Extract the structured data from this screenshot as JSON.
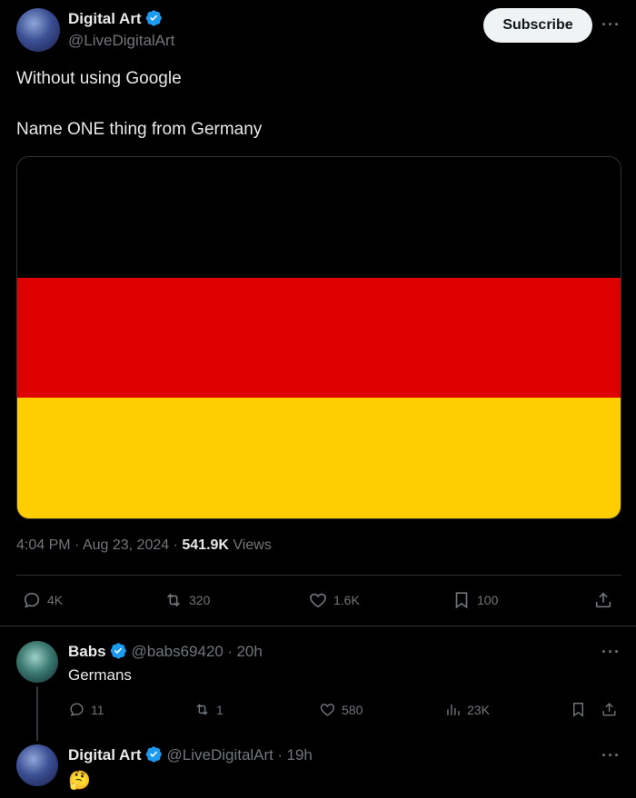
{
  "main_tweet": {
    "author_name": "Digital Art",
    "author_handle": "@LiveDigitalArt",
    "subscribe_label": "Subscribe",
    "more_label": "···",
    "text_line1": "Without using Google",
    "text_line2": "Name ONE thing from Germany",
    "flag_colors": [
      "#000000",
      "#DD0000",
      "#FFCE00"
    ],
    "time": "4:04 PM",
    "date": "Aug 23, 2024",
    "views_count": "541.9K",
    "views_label": "Views",
    "replies": "4K",
    "reposts": "320",
    "likes": "1.6K",
    "bookmarks": "100"
  },
  "reply": {
    "author_name": "Babs",
    "author_handle": "@babs69420",
    "age": "20h",
    "more_label": "···",
    "text": "Germans",
    "replies": "11",
    "reposts": "1",
    "likes": "580",
    "views": "23K"
  },
  "reply2": {
    "author_name": "Digital Art",
    "author_handle": "@LiveDigitalArt",
    "age": "19h",
    "more_label": "···",
    "text": "🤔"
  },
  "colors": {
    "background": "#000000",
    "verified": "#1d9bf0",
    "muted": "#71767b"
  }
}
